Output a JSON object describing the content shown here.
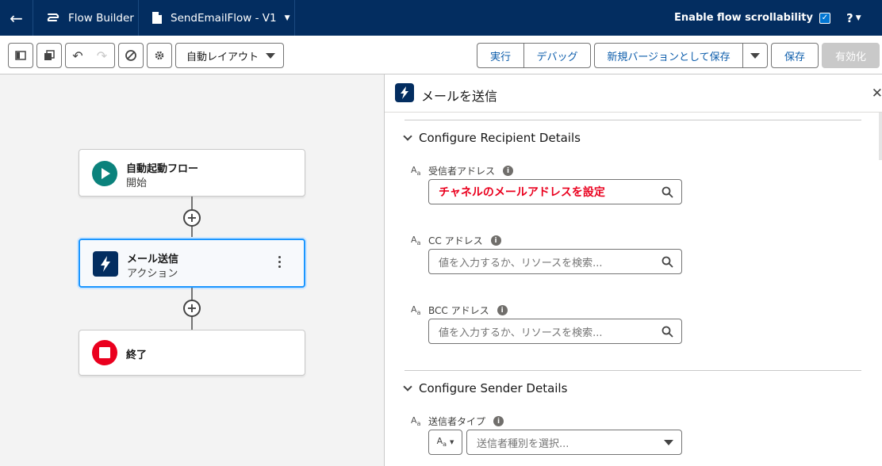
{
  "header": {
    "app_name": "Flow Builder",
    "flow_name": "SendEmailFlow - V1",
    "scroll_label": "Enable flow scrollability",
    "help": "?"
  },
  "toolbar": {
    "layout_select": "自動レイアウト",
    "run": "実行",
    "debug": "デバッグ",
    "save_as_new": "新規バージョンとして保存",
    "save": "保存",
    "activate": "有効化"
  },
  "canvas": {
    "nodes": [
      {
        "title": "自動起動フロー",
        "subtitle": "開始"
      },
      {
        "title": "メール送信",
        "subtitle": "アクション"
      },
      {
        "title": "終了",
        "subtitle": ""
      }
    ]
  },
  "panel": {
    "title": "メールを送信",
    "sections": [
      {
        "heading": "Configure Recipient Details",
        "fields": [
          {
            "label": "受信者アドレス",
            "value": "チャネルのメールアドレスを設定",
            "placeholder": ""
          },
          {
            "label": "CC アドレス",
            "value": "",
            "placeholder": "値を入力するか、リソースを検索..."
          },
          {
            "label": "BCC アドレス",
            "value": "",
            "placeholder": "値を入力するか、リソースを検索..."
          }
        ]
      },
      {
        "heading": "Configure Sender Details",
        "fields": [
          {
            "label": "送信者タイプ",
            "value": "",
            "placeholder": "送信者種別を選択..."
          }
        ]
      }
    ]
  },
  "colors": {
    "header_bg": "#032d60",
    "brand_blue": "#0176d3",
    "start_icon": "#0b827c",
    "end_icon": "#ea001e",
    "annotation_red": "#ea001e"
  }
}
